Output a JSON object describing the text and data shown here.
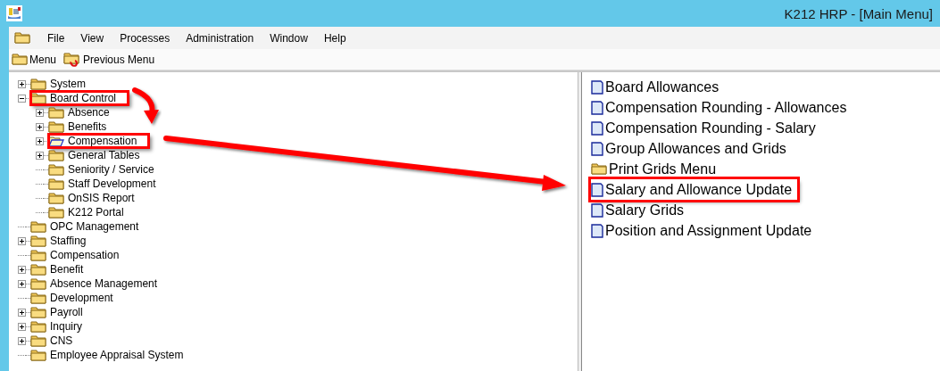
{
  "window": {
    "title": "K212 HRP - [Main Menu]"
  },
  "menu_bar": [
    {
      "label": "File"
    },
    {
      "label": "View"
    },
    {
      "label": "Processes"
    },
    {
      "label": "Administration"
    },
    {
      "label": "Window"
    },
    {
      "label": "Help"
    }
  ],
  "toolbar": [
    {
      "label": "Menu",
      "kind": "folder"
    },
    {
      "label": "Previous Menu",
      "kind": "back"
    }
  ],
  "tree": [
    {
      "label": "System",
      "expanded": false,
      "selected": false,
      "highlighted": false
    },
    {
      "label": "Board Control",
      "expanded": true,
      "selected": false,
      "highlighted": true,
      "children": [
        {
          "label": "Absence",
          "expanded": false,
          "selected": false,
          "highlighted": false
        },
        {
          "label": "Benefits",
          "expanded": false,
          "selected": false,
          "highlighted": false
        },
        {
          "label": "Compensation",
          "expanded": false,
          "selected": true,
          "highlighted": true
        },
        {
          "label": "General Tables",
          "expanded": false,
          "selected": false,
          "highlighted": false
        },
        {
          "label": "Seniority / Service",
          "selected": false,
          "highlighted": false
        },
        {
          "label": "Staff Development",
          "selected": false,
          "highlighted": false
        },
        {
          "label": "OnSIS Report",
          "selected": false,
          "highlighted": false
        },
        {
          "label": "K212 Portal",
          "selected": false,
          "highlighted": false
        }
      ]
    },
    {
      "label": "OPC Management",
      "selected": false,
      "highlighted": false
    },
    {
      "label": "Staffing",
      "expanded": false,
      "selected": false,
      "highlighted": false
    },
    {
      "label": "Compensation",
      "selected": false,
      "highlighted": false
    },
    {
      "label": "Benefit",
      "expanded": false,
      "selected": false,
      "highlighted": false
    },
    {
      "label": "Absence Management",
      "expanded": false,
      "selected": false,
      "highlighted": false
    },
    {
      "label": "Development",
      "selected": false,
      "highlighted": false
    },
    {
      "label": "Payroll",
      "expanded": false,
      "selected": false,
      "highlighted": false
    },
    {
      "label": "Inquiry",
      "expanded": false,
      "selected": false,
      "highlighted": false
    },
    {
      "label": "CNS",
      "expanded": false,
      "selected": false,
      "highlighted": false
    },
    {
      "label": "Employee Appraisal System",
      "selected": false,
      "highlighted": false
    }
  ],
  "list": [
    {
      "label": "Board Allowances",
      "kind": "document",
      "highlighted": false
    },
    {
      "label": "Compensation Rounding - Allowances",
      "kind": "document",
      "highlighted": false
    },
    {
      "label": "Compensation Rounding - Salary",
      "kind": "document",
      "highlighted": false
    },
    {
      "label": "Group Allowances and Grids",
      "kind": "document",
      "highlighted": false
    },
    {
      "label": "Print Grids Menu",
      "kind": "folder",
      "highlighted": false
    },
    {
      "label": "Salary and Allowance Update",
      "kind": "document",
      "highlighted": true
    },
    {
      "label": "Salary Grids",
      "kind": "document",
      "highlighted": false
    },
    {
      "label": "Position and Assignment Update",
      "kind": "document",
      "highlighted": false
    }
  ]
}
